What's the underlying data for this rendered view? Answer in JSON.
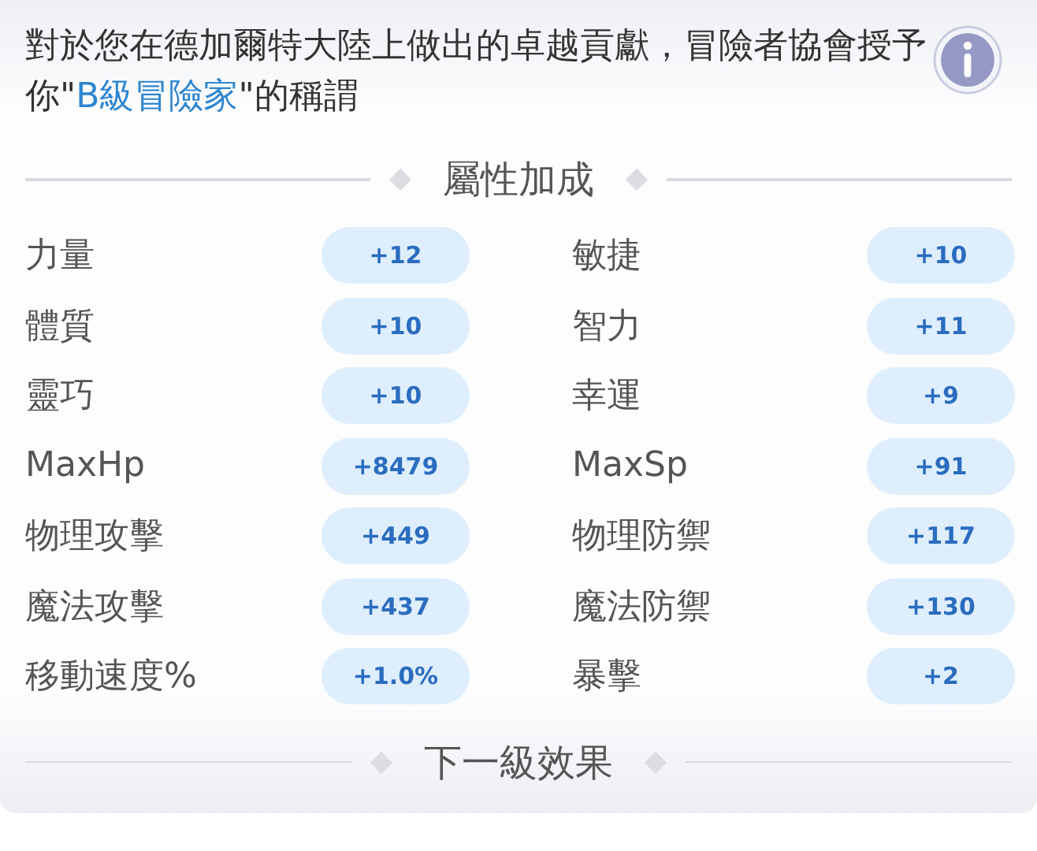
{
  "intro": {
    "before": "對於您在德加爾特大陸上做出的卓越貢獻，冒險者協會授予你\"",
    "highlight": "B級冒險家",
    "after": "\"的稱謂"
  },
  "sections": [
    {
      "title": "屬性加成",
      "stats": [
        {
          "label": "力量",
          "value": "+12"
        },
        {
          "label": "敏捷",
          "value": "+10"
        },
        {
          "label": "體質",
          "value": "+10"
        },
        {
          "label": "智力",
          "value": "+11"
        },
        {
          "label": "靈巧",
          "value": "+10"
        },
        {
          "label": "幸運",
          "value": "+9"
        },
        {
          "label": "MaxHp",
          "value": "+8479"
        },
        {
          "label": "MaxSp",
          "value": "+91"
        },
        {
          "label": "物理攻擊",
          "value": "+449"
        },
        {
          "label": "物理防禦",
          "value": "+117"
        },
        {
          "label": "魔法攻擊",
          "value": "+437"
        },
        {
          "label": "魔法防禦",
          "value": "+130"
        },
        {
          "label": "移動速度%",
          "value": "+1.0%"
        },
        {
          "label": "暴擊",
          "value": "+2"
        }
      ]
    },
    {
      "title": "下一級效果"
    }
  ]
}
